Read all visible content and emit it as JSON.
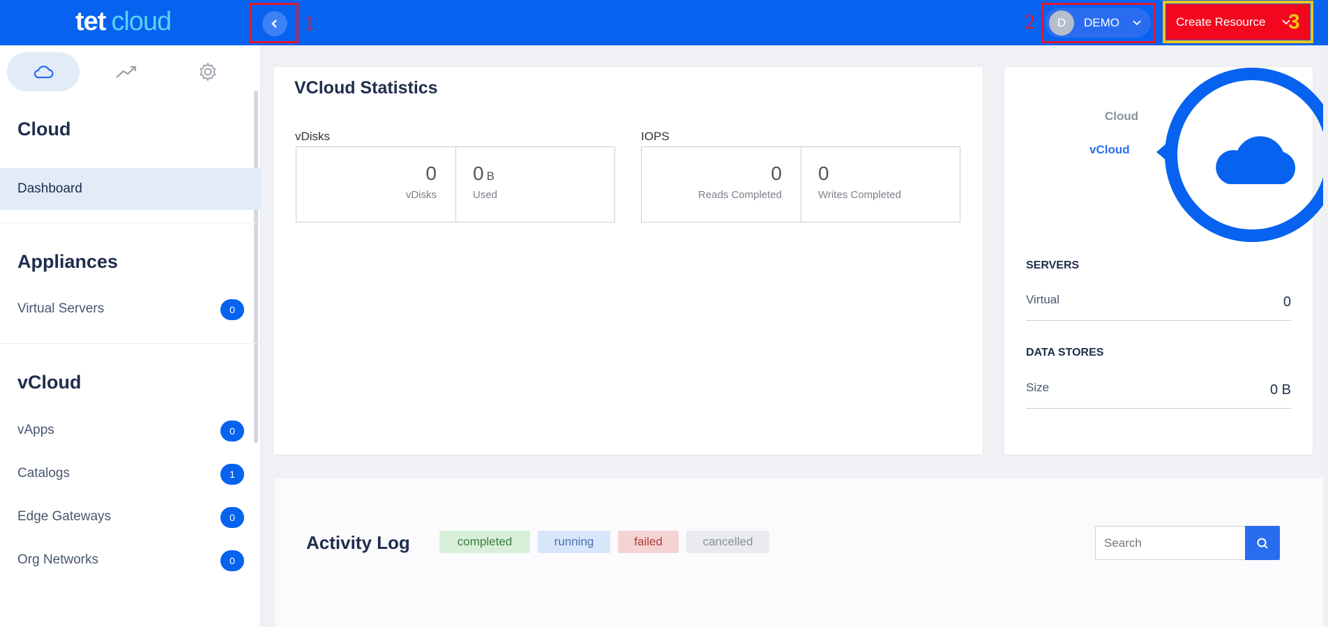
{
  "brand": {
    "logo_primary": "tet",
    "logo_secondary": "cloud",
    "bar_color": "#0762f0"
  },
  "annotations": {
    "n1": "1",
    "n2": "2",
    "n3": "3"
  },
  "user": {
    "initial": "D",
    "name": "DEMO"
  },
  "header": {
    "create_label": "Create Resource"
  },
  "sidebar": {
    "tabs": [
      {
        "icon": "cloud-icon",
        "active": true
      },
      {
        "icon": "trend-icon",
        "active": false
      },
      {
        "icon": "gear-icon",
        "active": false
      }
    ],
    "sections": [
      {
        "title": "Cloud",
        "items": [
          {
            "label": "Dashboard",
            "active": true
          }
        ]
      },
      {
        "title": "Appliances",
        "items": [
          {
            "label": "Virtual Servers",
            "count": "0"
          }
        ]
      },
      {
        "title": "vCloud",
        "items": [
          {
            "label": "vApps",
            "count": "0"
          },
          {
            "label": "Catalogs",
            "count": "1"
          },
          {
            "label": "Edge Gateways",
            "count": "0"
          },
          {
            "label": "Org Networks",
            "count": "0"
          }
        ]
      }
    ]
  },
  "stats": {
    "title": "VCloud Statistics",
    "vdisks": {
      "label": "vDisks",
      "count": "0",
      "count_caption": "vDisks",
      "used": "0",
      "used_unit": "B",
      "used_caption": "Used"
    },
    "iops": {
      "label": "IOPS",
      "reads": "0",
      "reads_caption": "Reads Completed",
      "writes": "0",
      "writes_caption": "Writes Completed"
    }
  },
  "panel": {
    "nav": [
      {
        "label": "Cloud",
        "active": false
      },
      {
        "label": "vCloud",
        "active": true
      }
    ],
    "servers": {
      "title": "SERVERS",
      "row_label": "Virtual",
      "row_value": "0"
    },
    "datastores": {
      "title": "DATA STORES",
      "row_label": "Size",
      "row_value": "0 B"
    }
  },
  "activity": {
    "title": "Activity Log",
    "filters": [
      {
        "label": "completed",
        "bg": "#d8f0d9",
        "fg": "#3a7d3d"
      },
      {
        "label": "running",
        "bg": "#d8e6fb",
        "fg": "#4a6fb0"
      },
      {
        "label": "failed",
        "bg": "#f6d3d3",
        "fg": "#b03b3b"
      },
      {
        "label": "cancelled",
        "bg": "#e9ebee",
        "fg": "#8a9099"
      }
    ],
    "search_placeholder": "Search"
  }
}
